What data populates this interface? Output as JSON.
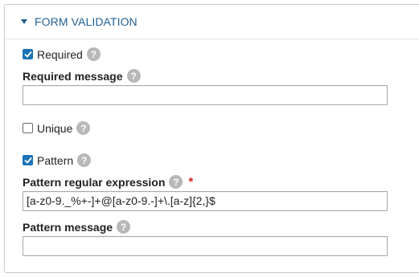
{
  "section": {
    "title": "FORM VALIDATION"
  },
  "required": {
    "checkbox_label": "Required",
    "checked": true,
    "help": "?",
    "message_label": "Required message",
    "message_value": ""
  },
  "unique": {
    "checkbox_label": "Unique",
    "checked": false,
    "help": "?"
  },
  "pattern": {
    "checkbox_label": "Pattern",
    "checked": true,
    "help": "?",
    "regex_label": "Pattern regular expression",
    "regex_required_marker": "*",
    "regex_value": "[a-z0-9._%+-]+@[a-z0-9.-]+\\.[a-z]{2,}$",
    "message_label": "Pattern message",
    "message_value": ""
  },
  "colors": {
    "accent": "#1f5f94",
    "checkbox_checked": "#1a73b8",
    "help_badge": "#b8b8b8",
    "required_marker": "#d81f1f"
  }
}
